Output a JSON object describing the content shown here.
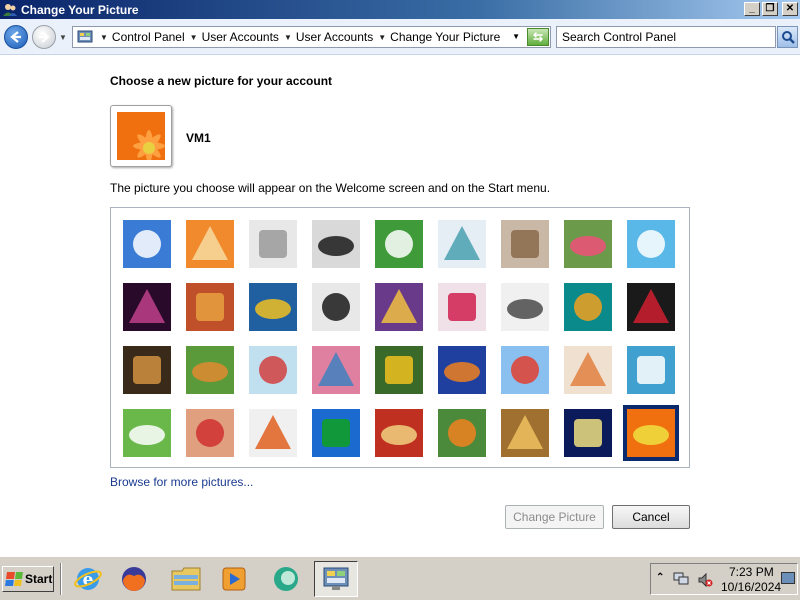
{
  "window": {
    "title": "Change Your Picture",
    "buttons": [
      "minimize",
      "restore",
      "close"
    ]
  },
  "address_bar": {
    "breadcrumbs": [
      "Control Panel",
      "User Accounts",
      "User Accounts",
      "Change Your Picture"
    ],
    "search_placeholder": "Search Control Panel"
  },
  "content": {
    "heading": "Choose a new picture for your account",
    "user_name": "VM1",
    "description": "The picture you choose will appear on the Welcome screen and on the Start menu.",
    "browse_link": "Browse for more pictures...",
    "change_button": "Change Picture",
    "cancel_button": "Cancel"
  },
  "pictures": [
    {
      "name": "rollercoaster",
      "bg": "#3a7bd5",
      "fg": "#ffffff"
    },
    {
      "name": "starfish",
      "bg": "#f08a2c",
      "fg": "#f7d9a0"
    },
    {
      "name": "robot-toy",
      "bg": "#e8e8e8",
      "fg": "#9a9a9a"
    },
    {
      "name": "vinyl-record",
      "bg": "#d9d9d9",
      "fg": "#1a1a1a"
    },
    {
      "name": "lucky-cat",
      "bg": "#3f9a3a",
      "fg": "#ffffff"
    },
    {
      "name": "gyroscope",
      "bg": "#e4eef4",
      "fg": "#4aa0b0"
    },
    {
      "name": "kitten",
      "bg": "#c9b8a6",
      "fg": "#8a6a4a"
    },
    {
      "name": "pink-flower",
      "bg": "#6a9a4a",
      "fg": "#f0507a"
    },
    {
      "name": "pinwheel",
      "bg": "#5ab8e8",
      "fg": "#ffffff"
    },
    {
      "name": "striped-ball",
      "bg": "#2a0a2a",
      "fg": "#c0408a"
    },
    {
      "name": "fabric-stripes",
      "bg": "#c0502a",
      "fg": "#e8a040"
    },
    {
      "name": "ginkgo-leaf",
      "bg": "#2060a0",
      "fg": "#f0c020"
    },
    {
      "name": "border-collie",
      "bg": "#e8e8e8",
      "fg": "#1a1a1a"
    },
    {
      "name": "crayons",
      "bg": "#6a3a8a",
      "fg": "#f0c040"
    },
    {
      "name": "red-leaf",
      "bg": "#f0e0e8",
      "fg": "#d02050"
    },
    {
      "name": "jacks",
      "bg": "#f0f0f0",
      "fg": "#4a4a4a"
    },
    {
      "name": "stairs",
      "bg": "#0a8a8a",
      "fg": "#f0a020"
    },
    {
      "name": "origami-crane",
      "bg": "#1a1a1a",
      "fg": "#d02030"
    },
    {
      "name": "guitar",
      "bg": "#3a2a1a",
      "fg": "#d09040"
    },
    {
      "name": "pomeranian",
      "bg": "#5a9a3a",
      "fg": "#e08a30"
    },
    {
      "name": "tin-robot",
      "bg": "#c0e0f0",
      "fg": "#d04040"
    },
    {
      "name": "fabric-swirl",
      "bg": "#e080a0",
      "fg": "#4080c0"
    },
    {
      "name": "sunflower",
      "bg": "#3a6a2a",
      "fg": "#f0c020"
    },
    {
      "name": "goldfish",
      "bg": "#2040a0",
      "fg": "#f08020"
    },
    {
      "name": "hot-air-balloon",
      "bg": "#8ac0f0",
      "fg": "#e04030"
    },
    {
      "name": "daruma-doll",
      "bg": "#f0e0d0",
      "fg": "#e08040"
    },
    {
      "name": "sailboat",
      "bg": "#40a0d0",
      "fg": "#ffffff"
    },
    {
      "name": "soccer-ball",
      "bg": "#6ab84a",
      "fg": "#ffffff"
    },
    {
      "name": "fabric-weave",
      "bg": "#e0a080",
      "fg": "#d03030"
    },
    {
      "name": "marbles",
      "bg": "#f0f0f0",
      "fg": "#e06020"
    },
    {
      "name": "green-window",
      "bg": "#1a6ad0",
      "fg": "#10a020"
    },
    {
      "name": "embroidery",
      "bg": "#c03020",
      "fg": "#f0d080"
    },
    {
      "name": "butterfly",
      "bg": "#4a8a3a",
      "fg": "#f08020"
    },
    {
      "name": "wicker-pattern",
      "bg": "#a07030",
      "fg": "#f0c060"
    },
    {
      "name": "lighthouse",
      "bg": "#0a1a5a",
      "fg": "#f0e080"
    },
    {
      "name": "orange-gerbera",
      "bg": "#f07010",
      "fg": "#f0e040"
    }
  ],
  "selected_index": 35,
  "taskbar": {
    "start_label": "Start",
    "apps": [
      "internet-explorer",
      "firefox",
      "windows-explorer",
      "media-player",
      "messenger",
      "control-panel"
    ],
    "time": "7:23 PM",
    "date": "10/16/2024"
  }
}
